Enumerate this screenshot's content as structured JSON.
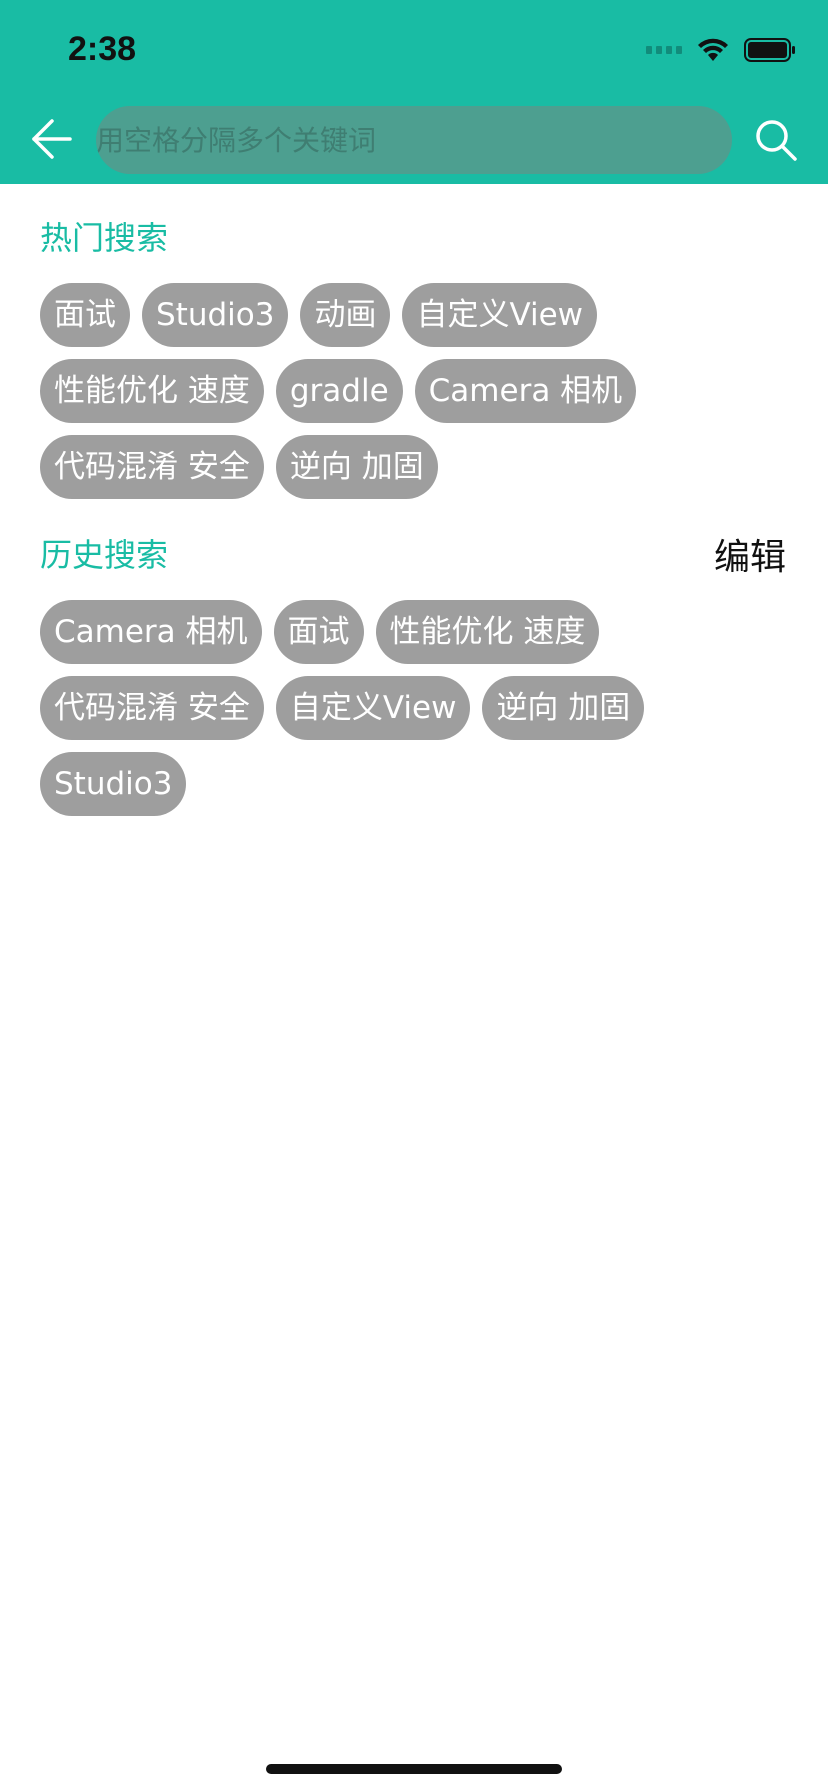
{
  "status_bar": {
    "time": "2:38"
  },
  "search": {
    "placeholder": "用空格分隔多个关键词",
    "value": ""
  },
  "hot_section": {
    "title": "热门搜索",
    "tags": [
      "面试",
      "Studio3",
      "动画",
      "自定义View",
      "性能优化 速度",
      "gradle",
      "Camera 相机",
      "代码混淆 安全",
      "逆向 加固"
    ]
  },
  "history_section": {
    "title": "历史搜索",
    "edit_label": "编辑",
    "tags": [
      "Camera 相机",
      "面试",
      "性能优化 速度",
      "代码混淆 安全",
      "自定义View",
      "逆向 加固",
      "Studio3"
    ]
  },
  "icons": {
    "back": "arrow-left-icon",
    "search": "search-icon",
    "wifi": "wifi-icon",
    "battery": "battery-icon",
    "signal": "cellular-signal-icon"
  },
  "colors": {
    "accent": "#19bca4",
    "tag_bg": "#9e9e9e",
    "search_field_bg": "#4d9f90"
  }
}
